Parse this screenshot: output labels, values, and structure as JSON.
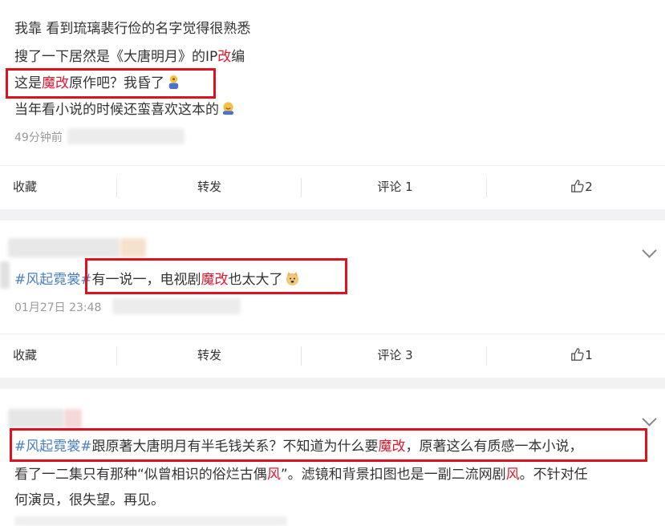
{
  "post1": {
    "line1": "我靠 看到琉璃裴行俭的名字觉得很熟悉",
    "line2_a": "搜了一下居然是《大唐明月》的IP",
    "line2_red": "改",
    "line2_b": "编",
    "line3_a": "这是",
    "line3_red": "魔改",
    "line3_b": "原作吧？我昏了",
    "line4": "当年看小说的时候还蛮喜欢这本的",
    "time": "49分钟前"
  },
  "actions1": {
    "favorite": "收藏",
    "repost": "转发",
    "comment": "评论 1",
    "like_count": "2"
  },
  "post2": {
    "hashtag": "#风起霓裳#",
    "text_a": "有一说一，电视剧",
    "text_red": "魔改",
    "text_b": "也太大了",
    "time": "01月27日 23:48"
  },
  "actions2": {
    "favorite": "收藏",
    "repost": "转发",
    "comment": "评论 3",
    "like_count": "1"
  },
  "post3": {
    "hashtag": "#风起霓裳#",
    "l1_a": "跟原著大唐明月有半毛钱关系？不知道为什么要",
    "l1_red": "魔改",
    "l1_b": "，原著这么有质感一本小说，",
    "l2_a": "看了一二集只有那种“似曾相识的俗烂古偶",
    "l2_red1": "风",
    "l2_b": "”。滤镜和背景扣图也是一副二流网剧",
    "l2_red2": "风",
    "l2_c": "。不针对任",
    "l3": "何演员，很失望。再见。"
  },
  "colors": {
    "accent_red": "#e6162d",
    "hashtag_blue": "#4a7fc1",
    "box_red": "#e0111f"
  }
}
